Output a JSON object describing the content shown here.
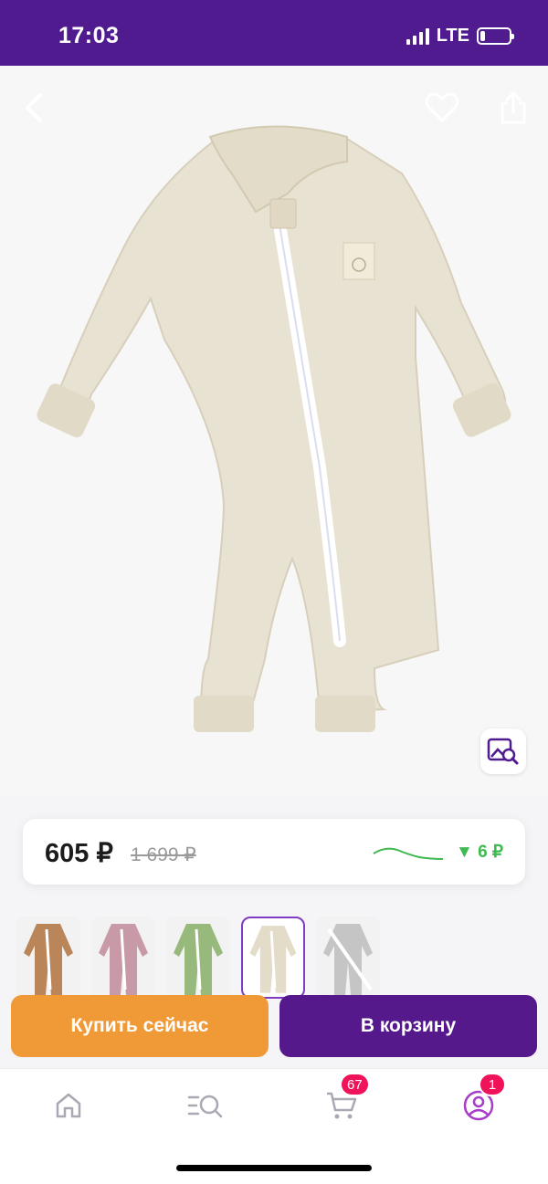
{
  "status_bar": {
    "time": "17:03",
    "network": "LTE",
    "battery_level": 0.15
  },
  "icons": {
    "back": "chevron-left-icon",
    "favorite": "heart-outline-icon",
    "share": "share-icon",
    "photo_search": "image-search-icon",
    "home": "home-icon",
    "catalog": "catalog-search-icon",
    "cart": "cart-icon",
    "profile": "profile-icon"
  },
  "product": {
    "price": "605 ₽",
    "old_price": "1 699 ₽",
    "price_change": "▼ 6 ₽",
    "color_variants": [
      "brown",
      "pink",
      "green",
      "beige",
      "gray"
    ],
    "selected_variant": "beige"
  },
  "actions": {
    "buy_now": "Купить сейчас",
    "add_to_cart": "В корзину"
  },
  "tabbar": {
    "cart_badge": "67",
    "profile_badge": "1"
  },
  "colors": {
    "brand_purple": "#4f1b8f",
    "buy_orange": "#f09a37",
    "cart_purple": "#55198c",
    "trend_green": "#3fb950",
    "badge_red": "#f0135a"
  }
}
